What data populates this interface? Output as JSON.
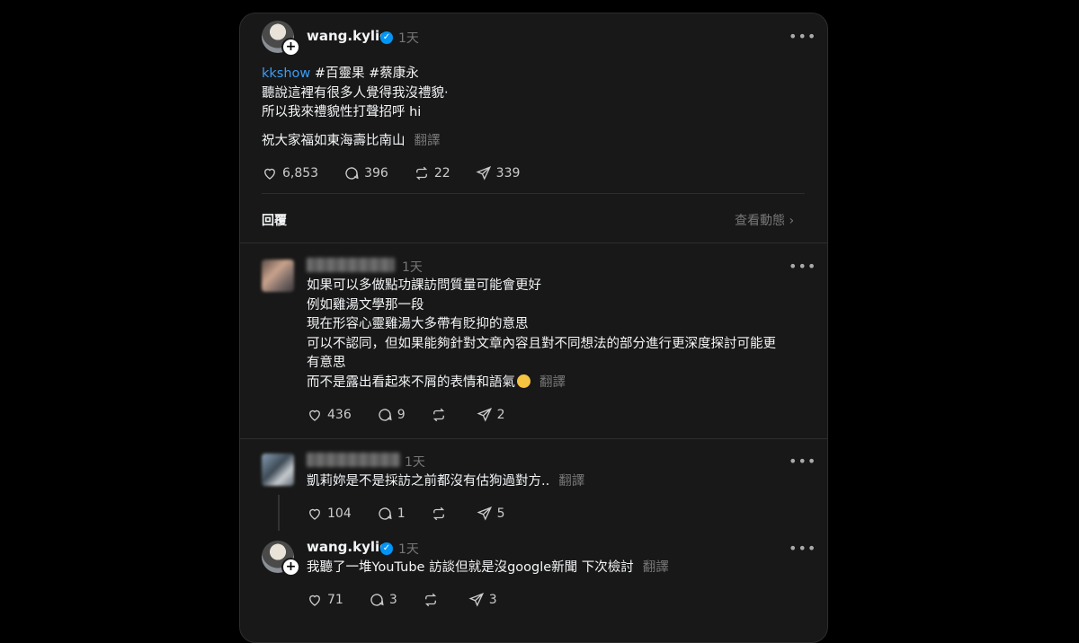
{
  "main_post": {
    "username": "wang.kylie",
    "time": "1天",
    "link_text": "kkshow",
    "tags": "#百靈果 #蔡康永",
    "lines": [
      "聽說這裡有很多人覺得我沒禮貌‧",
      "所以我來禮貌性打聲招呼 hi"
    ],
    "wish": "祝大家福如東海壽比南山",
    "translate": "翻譯",
    "likes": "6,853",
    "comments": "396",
    "reposts": "22",
    "shares": "339"
  },
  "replies_header": {
    "label": "回覆",
    "activity": "查看動態"
  },
  "reply1": {
    "time": "1天",
    "lines": [
      "如果可以多做點功課訪問質量可能會更好",
      "例如雞湯文學那一段",
      "現在形容心靈雞湯大多帶有貶抑的意思",
      "可以不認同，但如果能夠針對文章內容且對不同想法的部分進行更深度探討可能更",
      "有意思",
      "而不是露出看起來不屑的表情和語氣"
    ],
    "translate": "翻譯",
    "likes": "436",
    "comments": "9",
    "shares": "2"
  },
  "reply2": {
    "time": "1天",
    "text": "凱莉妳是不是採訪之前都沒有估狗過對方..",
    "translate": "翻譯",
    "likes": "104",
    "comments": "1",
    "shares": "5"
  },
  "reply3": {
    "username": "wang.kylie",
    "time": "1天",
    "text": "我聽了一堆YouTube 訪談但就是沒google新聞 下次檢討",
    "translate": "翻譯",
    "likes": "71",
    "comments": "3",
    "shares": "3"
  },
  "icons": {
    "heart": "heart-icon",
    "comment": "comment-icon",
    "repost": "repost-icon",
    "share": "share-icon",
    "verified": "verified-badge-icon",
    "more": "more-icon"
  },
  "colors": {
    "background": "#000000",
    "card": "#181818",
    "link": "#3b9df5",
    "verified": "#0095f6"
  }
}
